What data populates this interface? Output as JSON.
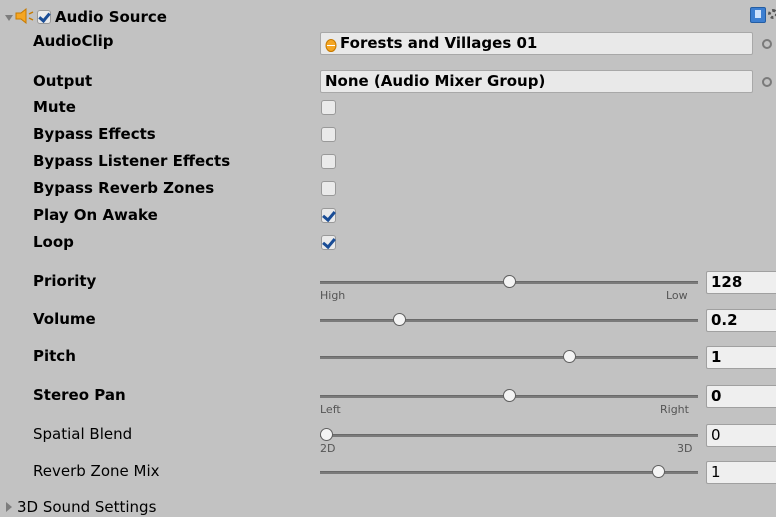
{
  "header": {
    "title": "Audio Source",
    "enabled": true
  },
  "fields": {
    "audio_clip": {
      "label": "AudioClip",
      "value": "Forests and Villages 01"
    },
    "output": {
      "label": "Output",
      "value": "None (Audio Mixer Group)"
    }
  },
  "toggles": [
    {
      "label": "Mute",
      "checked": false
    },
    {
      "label": "Bypass Effects",
      "checked": false
    },
    {
      "label": "Bypass Listener Effects",
      "checked": false
    },
    {
      "label": "Bypass Reverb Zones",
      "checked": false
    },
    {
      "label": "Play On Awake",
      "checked": true
    },
    {
      "label": "Loop",
      "checked": true
    }
  ],
  "sliders": [
    {
      "label": "Priority",
      "value": "128",
      "fraction": 0.5,
      "min_label": "High",
      "max_label": "Low"
    },
    {
      "label": "Volume",
      "value": "0.2",
      "fraction": 0.2
    },
    {
      "label": "Pitch",
      "value": "1",
      "fraction": 0.667
    },
    {
      "label": "Stereo Pan",
      "value": "0",
      "fraction": 0.5,
      "min_label": "Left",
      "max_label": "Right"
    },
    {
      "label": "Spatial Blend",
      "value": "0",
      "fraction": 0.0,
      "min_label": "2D",
      "max_label": "3D"
    },
    {
      "label": "Reverb Zone Mix",
      "value": "1",
      "fraction": 0.909
    }
  ],
  "footer": {
    "label": "3D Sound Settings"
  },
  "colors": {
    "panel": "#c2c2c2",
    "checkmark": "#1a4d96",
    "field": "#e9e9e9"
  },
  "icons": {
    "header": "speaker-icon",
    "clip": "audio-clip-icon",
    "help": "help-book-icon",
    "settings": "gear-icon"
  }
}
